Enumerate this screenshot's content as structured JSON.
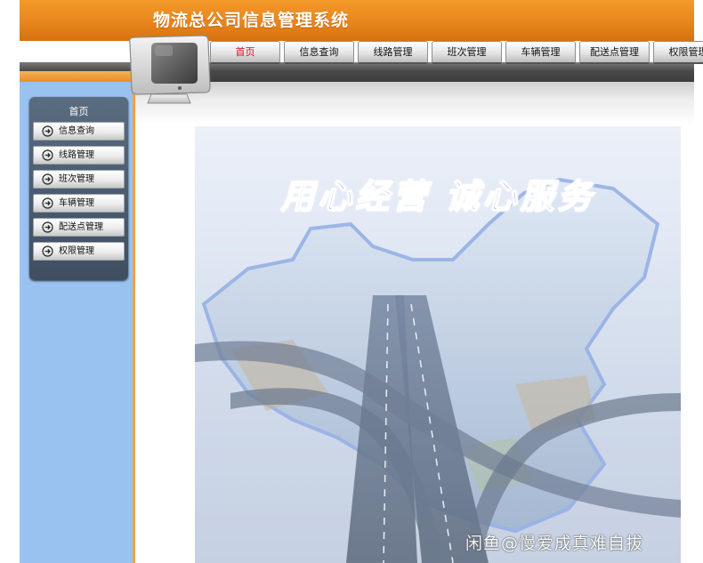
{
  "app": {
    "title": "物流总公司信息管理系统"
  },
  "nav": {
    "tabs": [
      {
        "label": "首页",
        "active": true
      },
      {
        "label": "信息查询"
      },
      {
        "label": "线路管理"
      },
      {
        "label": "班次管理"
      },
      {
        "label": "车辆管理"
      },
      {
        "label": "配送点管理"
      },
      {
        "label": "权限管理"
      }
    ]
  },
  "sidebar": {
    "title": "首页",
    "items": [
      {
        "label": "信息查询"
      },
      {
        "label": "线路管理"
      },
      {
        "label": "班次管理"
      },
      {
        "label": "车辆管理"
      },
      {
        "label": "配送点管理"
      },
      {
        "label": "权限管理"
      }
    ]
  },
  "banner": {
    "slogan": "用心经营 诚心服务"
  },
  "watermark": "闲鱼@慢爱成真难自拔",
  "colors": {
    "header_orange": "#e7831b",
    "sidebar_blue": "#99c2f0",
    "active_tab_red": "#d4101a",
    "menu_panel": "#4a5a6c",
    "slogan_blue": "#6f8fd6"
  },
  "icons": {
    "menu_item": "circle-arrow-right-icon",
    "logo": "monitor-icon"
  }
}
